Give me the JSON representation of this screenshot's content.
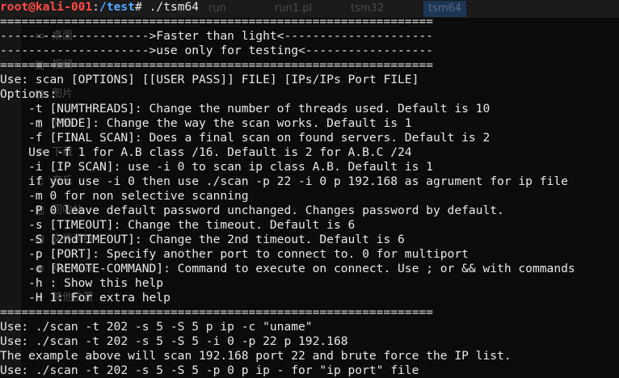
{
  "background_window": {
    "tabs": [
      "run",
      "run1.pl",
      "tsm32",
      "tsm64"
    ],
    "active_tab": "tsm64",
    "sidebar_items": [
      {
        "label": "桌面",
        "icon": "desktop-icon",
        "glyph": "▭"
      },
      {
        "label": "视频",
        "icon": "video-icon",
        "glyph": "▣"
      },
      {
        "label": "图片",
        "icon": "image-icon",
        "glyph": "▧"
      },
      {
        "label": "文档",
        "icon": "document-icon",
        "glyph": "▯"
      },
      {
        "label": "下载",
        "icon": "download-icon",
        "glyph": "⊙"
      },
      {
        "label": "音乐",
        "icon": "music-icon",
        "glyph": "♫"
      },
      {
        "label": "回收站",
        "icon": "trash-icon",
        "glyph": "▥"
      },
      {
        "label": "文件系统",
        "icon": "drive-icon",
        "glyph": "▤"
      },
      {
        "label": "Kali Live",
        "icon": "disc-icon",
        "glyph": "◉"
      },
      {
        "label": "其他位置",
        "icon": "plus-icon",
        "glyph": "+"
      }
    ]
  },
  "terminal": {
    "prompt": {
      "user_host": "root@kali-001",
      "separator": ":",
      "path": "/test",
      "symbol": "# ",
      "command": "./tsm64"
    },
    "lines": [
      "=============================================================",
      "--------------------->Faster than light<---------------------",
      "--------------------->use only for testing<------------------",
      "=============================================================",
      "Use: scan [OPTIONS] [[USER PASS]] FILE] [IPs/IPs Port FILE]",
      "Options:",
      "    -t [NUMTHREADS]: Change the number of threads used. Default is 10",
      "    -m [MODE]: Change the way the scan works. Default is 1",
      "    -f [FINAL SCAN]: Does a final scan on found servers. Default is 2",
      "    Use -f 1 for A.B class /16. Default is 2 for A.B.C /24",
      "    -i [IP SCAN]: use -i 0 to scan ip class A.B. Default is 1",
      "    if you use -i 0 then use ./scan -p 22 -i 0 p 192.168 as agrument for ip file",
      "    -m 0 for non selective scanning",
      "    -P 0 leave default password unchanged. Changes password by default.",
      "    -s [TIMEOUT]: Change the timeout. Default is 6",
      "    -S [2ndTIMEOUT]: Change the 2nd timeout. Default is 6",
      "    -p [PORT]: Specify another port to connect to. 0 for multiport",
      "    -c [REMOTE-COMMAND]: Command to execute on connect. Use ; or && with commands",
      "    -h : Show this help",
      "    -H 1: For extra help",
      "=============================================================",
      "Use: ./scan -t 202 -s 5 -S 5 p ip -c \"uname\"",
      "Use: ./scan -t 202 -s 5 -S 5 -i 0 -p 22 p 192.168",
      "The example above will scan 192.168 port 22 and brute force the IP list.",
      "Use: ./scan -t 202 -s 5 -S 5 -p 0 p ip - for \"ip port\" file"
    ]
  }
}
